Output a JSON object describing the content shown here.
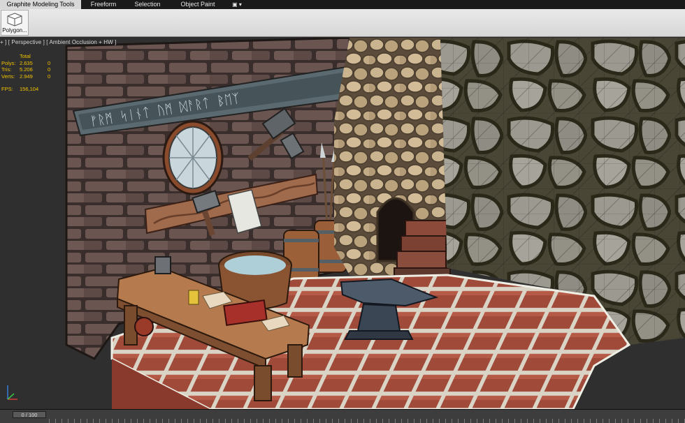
{
  "tabs": [
    "Graphite Modeling Tools",
    "Freeform",
    "Selection",
    "Object Paint",
    "▣ ▾"
  ],
  "ribbon": {
    "polygon_button": "Polygon..."
  },
  "viewport": {
    "label": "+ ] [ Perspective ] [ Ambient Occlusion + HW ]",
    "stats": {
      "header": "Total",
      "rows": [
        {
          "name": "Polys:",
          "total": "2.635",
          "sel": "0"
        },
        {
          "name": "Tris:",
          "total": "5.206",
          "sel": "0"
        },
        {
          "name": "Verts:",
          "total": "2.949",
          "sel": "0"
        }
      ],
      "fps_label": "FPS:",
      "fps_value": "156,104"
    }
  },
  "timeline": {
    "frame": "0 / 100"
  },
  "colors": {
    "stats_text": "#f2c400",
    "ribbon_bg": "#dcdcdc",
    "tab_bg": "#1a1a1a"
  }
}
